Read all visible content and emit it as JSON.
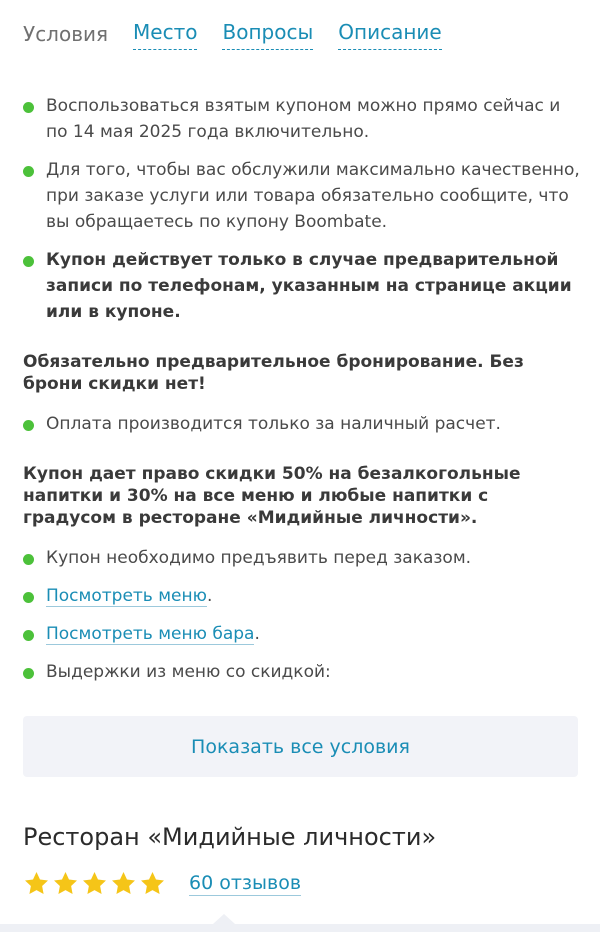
{
  "tabs": [
    {
      "label": "Условия",
      "active": true
    },
    {
      "label": "Место",
      "active": false
    },
    {
      "label": "Вопросы",
      "active": false
    },
    {
      "label": "Описание",
      "active": false
    }
  ],
  "conditions": {
    "item1": "Воспользоваться взятым купоном можно прямо сейчас и по 14 мая 2025 года включительно.",
    "item2": "Для того, чтобы вас обслужили максимально качественно, при заказе услуги или товара обязательно сообщите, что вы обращаетесь по купону Boombate.",
    "item3": "Купон действует только в случае предварительной записи по телефонам, указанным на странице акции или в купоне.",
    "para1": "Обязательно предварительное бронирование. Без брони скидки нет!",
    "item4": "Оплата производится только за наличный расчет.",
    "para2": "Купон дает право скидки 50% на безалкогольные напитки и 30% на все меню и любые напитки с градусом в ресторане «Мидийные личности».",
    "item5": "Купон необходимо предъявить перед заказом.",
    "link1": "Посмотреть меню",
    "link2": "Посмотреть меню бара",
    "item8": "Выдержки из меню со скидкой:"
  },
  "show_all_label": "Показать все условия",
  "restaurant": {
    "title": "Ресторан «Мидийные личности»",
    "rating_stars": 5,
    "reviews_label": "60 отзывов"
  },
  "colors": {
    "accent": "#1a8db5",
    "bullet": "#4cc13a",
    "star": "#f5c518"
  }
}
